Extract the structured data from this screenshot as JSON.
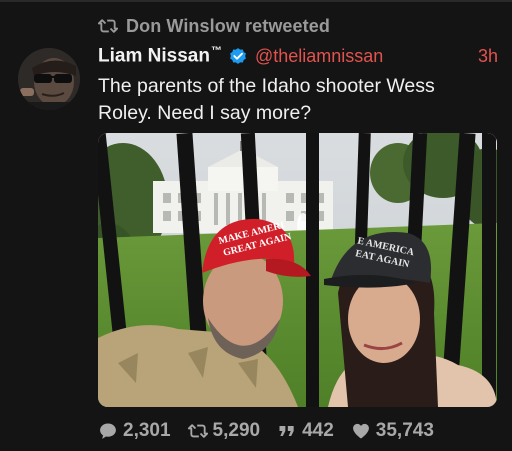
{
  "retweet": {
    "label": "Don Winslow retweeted",
    "icon": "retweet-icon"
  },
  "tweet": {
    "author_name": "Liam Nissan",
    "trademark": "™",
    "handle": "@theliamnissan",
    "time": "3h",
    "verified": true,
    "text": "The parents of the Idaho shooter Wess Roley. Need I say more?"
  },
  "media": {
    "red_hat_text_line1": "MAKE AMERI",
    "red_hat_text_line2": "GREAT AGAIN",
    "black_hat_text_line1": "E AMERICA",
    "black_hat_text_line2": "EAT AGAIN"
  },
  "stats": {
    "replies": "2,301",
    "retweets": "5,290",
    "quotes": "442",
    "likes": "35,743"
  },
  "colors": {
    "background": "#141414",
    "accent": "#e2534f",
    "muted": "#9a9a9a",
    "verified_badge": "#1d9bf0"
  }
}
